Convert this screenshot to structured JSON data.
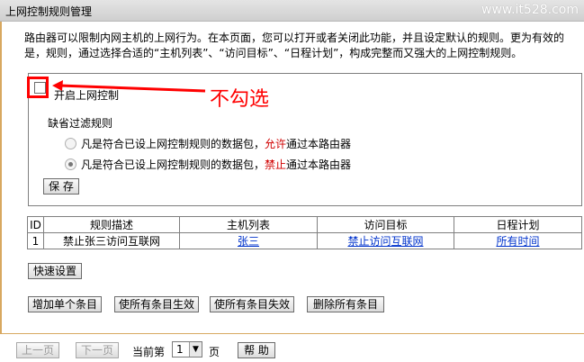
{
  "header": {
    "title": "上网控制规则管理",
    "watermark": "www.it528.com"
  },
  "description": "路由器可以限制内网主机的上网行为。在本页面，您可以打开或者关闭此功能，并且设定默认的规则。更为有效的是，规则，通过选择合适的“主机列表”、“访问目标”、“日程计划”，构成完整而又强大的上网控制规则。",
  "control": {
    "enable_label": "开启上网控制",
    "enable_checked": false,
    "default_rule_title": "缺省过滤规则",
    "option_allow": {
      "prefix": "凡是符合已设上网控制规则的数据包，",
      "keyword": "允许",
      "suffix": "通过本路由器",
      "selected": false
    },
    "option_deny": {
      "prefix": "凡是符合已设上网控制规则的数据包，",
      "keyword": "禁止",
      "suffix": "通过本路由器",
      "selected": true
    },
    "save_label": "保 存"
  },
  "annotation": {
    "text": "不勾选",
    "color": "#ff0000"
  },
  "table": {
    "headers": [
      "ID",
      "规则描述",
      "主机列表",
      "访问目标",
      "日程计划"
    ],
    "rows": [
      {
        "id": "1",
        "description": "禁止张三访问互联网",
        "hosts": "张三",
        "target": "禁止访问互联网",
        "schedule": "所有时间"
      }
    ]
  },
  "buttons": {
    "quick_setup": "快速设置",
    "add_single": "增加单个条目",
    "enable_all": "使所有条目生效",
    "disable_all": "使所有条目失效",
    "delete_all": "删除所有条目"
  },
  "pagination": {
    "prev": "上一页",
    "next": "下一页",
    "current_label": "当前第",
    "page_value": "1",
    "page_unit": "页",
    "help": "帮 助"
  },
  "colors": {
    "accent_rule": "#d8a860",
    "link": "#0033cc",
    "warning": "#d00000"
  }
}
